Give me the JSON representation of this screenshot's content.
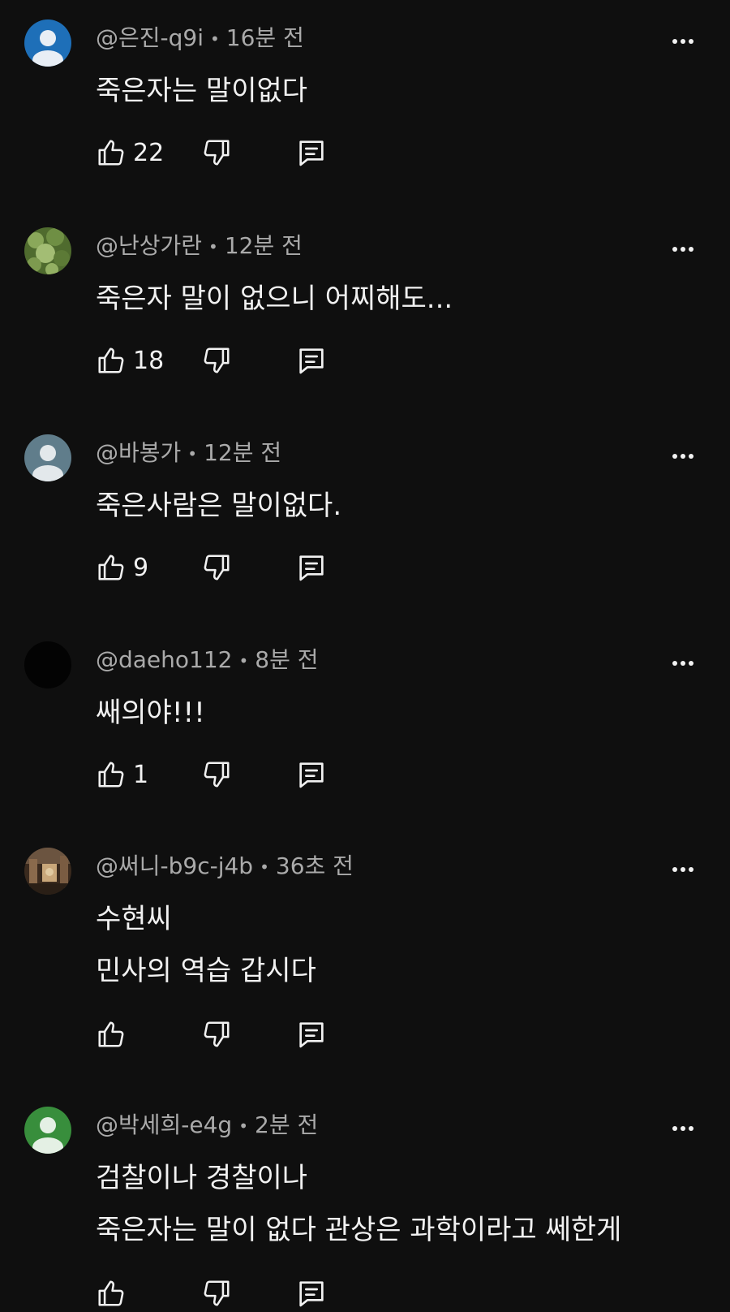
{
  "comments": [
    {
      "handle": "@은진-q9i",
      "time": "16분 전",
      "lines": [
        "죽은자는 말이없다"
      ],
      "likes": "22",
      "avatar": "default-blue"
    },
    {
      "handle": "@난상가란",
      "time": "12분 전",
      "lines": [
        "죽은자 말이 없으니 어찌해도..."
      ],
      "likes": "18",
      "avatar": "photo-green-leaves"
    },
    {
      "handle": "@바봉가",
      "time": "12분 전",
      "lines": [
        "죽은사람은 말이없다."
      ],
      "likes": "9",
      "avatar": "default-gray"
    },
    {
      "handle": "@daeho112",
      "time": "8분 전",
      "lines": [
        "쌔의야!!!"
      ],
      "likes": "1",
      "avatar": "black"
    },
    {
      "handle": "@써니-b9c-j4b",
      "time": "36초 전",
      "lines": [
        "수현씨",
        "민사의 역습 갑시다"
      ],
      "likes": "",
      "avatar": "photo-room"
    },
    {
      "handle": "@박세희-e4g",
      "time": "2분 전",
      "lines": [
        "검찰이나 경찰이나",
        "죽은자는 말이 없다 관상은 과학이라고 쎄한게"
      ],
      "likes": "",
      "avatar": "default-green"
    }
  ],
  "separator": "•",
  "icons": {
    "like": "thumbs-up-icon",
    "dislike": "thumbs-down-icon",
    "reply": "reply-icon",
    "more": "more-vertical-icon"
  },
  "colors": {
    "background": "#0f0f0f",
    "text": "#f1f1f1",
    "meta": "#aaaaaa",
    "avatar_blue": "#1e6fb8",
    "avatar_gray": "#607d8b",
    "avatar_green": "#388e3c"
  }
}
